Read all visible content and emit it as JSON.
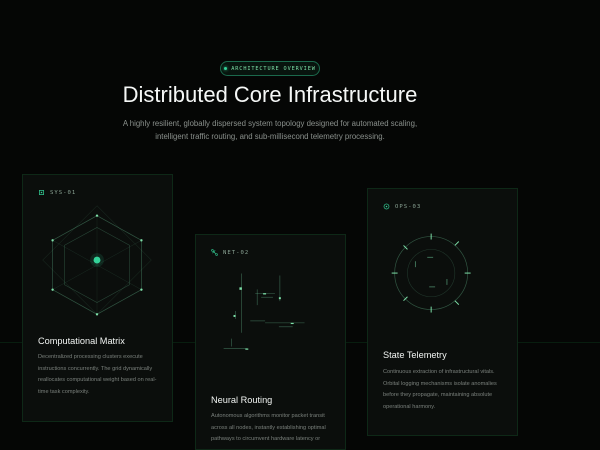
{
  "badge": {
    "label": "ARCHITECTURE OVERVIEW"
  },
  "hero": {
    "title": "Distributed Core Infrastructure",
    "subtitle": "A highly resilient, globally dispersed system topology designed for automated scaling, intelligent traffic routing, and sub-millisecond telemetry processing."
  },
  "cards": [
    {
      "tag": "SYS-01",
      "icon": "chip-icon",
      "title": "Computational Matrix",
      "description": "Decentralized processing clusters execute instructions concurrently. The grid dynamically reallocates computational weight based on real-time task complexity."
    },
    {
      "tag": "NET-02",
      "icon": "network-icon",
      "title": "Neural Routing",
      "description": "Autonomous algorithms monitor packet transit across all nodes, instantly establishing optimal pathways to circumvent hardware latency or"
    },
    {
      "tag": "OPS-03",
      "icon": "target-icon",
      "title": "State Telemetry",
      "description": "Continuous extraction of infrastructural vitals. Orbital logging mechanisms isolate anomalies before they propagate, maintaining absolute operational harmony."
    }
  ],
  "colors": {
    "accent": "#34d399",
    "background": "#050605",
    "card": "#0b0e0c"
  }
}
